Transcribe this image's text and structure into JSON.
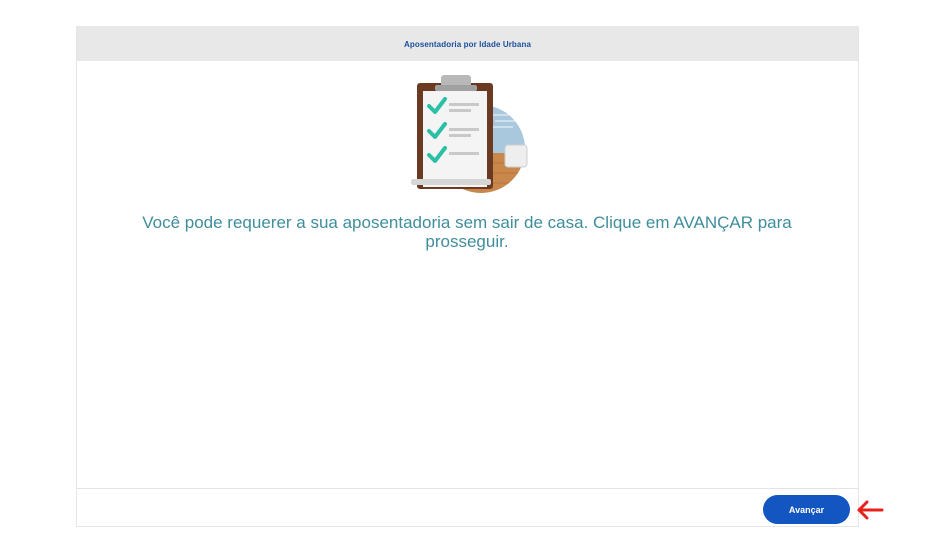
{
  "panel": {
    "title": "Aposentadoria por Idade Urbana"
  },
  "main": {
    "illustration_icon": "clipboard-checklist-icon",
    "message": "Você pode requerer a sua aposentadoria sem sair de casa. Clique em AVANÇAR para prosseguir."
  },
  "footer": {
    "advance_label": "Avançar"
  },
  "annotation": {
    "icon": "arrow-left-icon",
    "color": "#e8201b"
  },
  "colors": {
    "header_bg": "#e8e8e8",
    "title_text": "#1b4f9c",
    "message_text": "#3f8e9c",
    "button_bg": "#1356c2"
  }
}
